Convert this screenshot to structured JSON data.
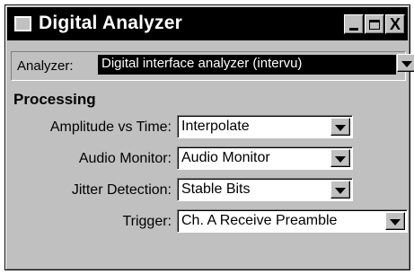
{
  "window": {
    "title": "Digital Analyzer",
    "minimize_glyph": "_",
    "maximize_glyph": "□",
    "close_glyph": "X"
  },
  "analyzer": {
    "label": "Analyzer:",
    "selected": "Digital interface analyzer (intervu)"
  },
  "processing": {
    "title": "Processing",
    "params": [
      {
        "label": "Amplitude vs Time:",
        "value": "Interpolate"
      },
      {
        "label": "Audio Monitor:",
        "value": "Audio Monitor"
      },
      {
        "label": "Jitter Detection:",
        "value": "Stable Bits"
      },
      {
        "label": "Trigger:",
        "value": "Ch. A Receive Preamble"
      }
    ]
  }
}
